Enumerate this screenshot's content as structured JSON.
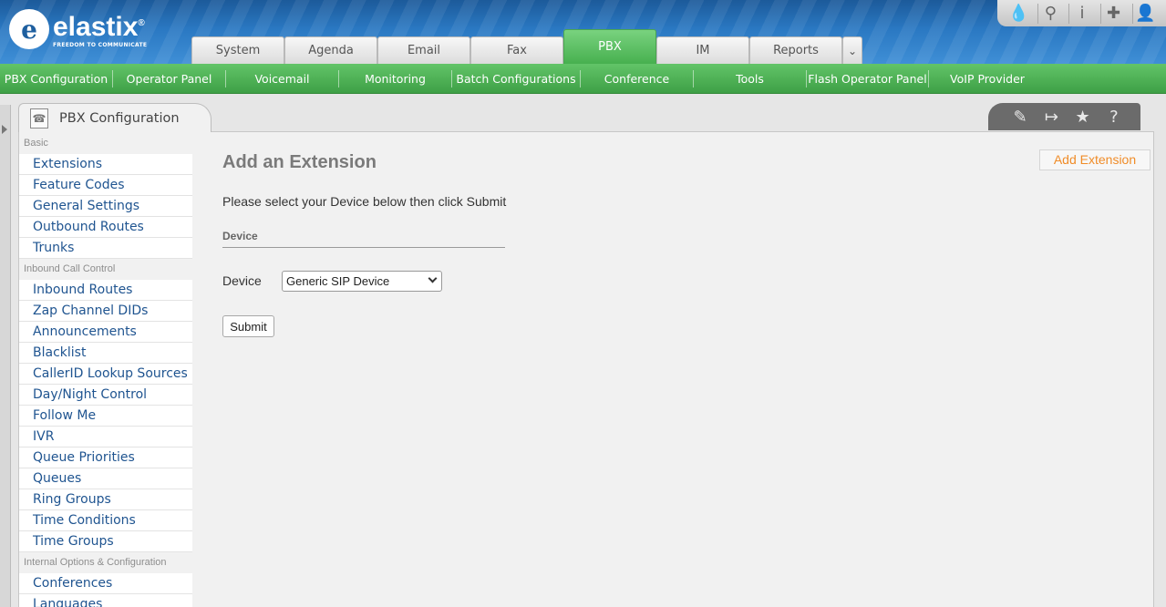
{
  "brand": {
    "name": "elastix",
    "registered": "®",
    "slogan": "FREEDOM TO COMMUNICATE"
  },
  "top_icons": [
    {
      "name": "theme-drop-icon",
      "glyph": "💧"
    },
    {
      "name": "search-icon",
      "glyph": "⚲"
    },
    {
      "name": "info-icon",
      "glyph": "i"
    },
    {
      "name": "addons-puzzle-icon",
      "glyph": "✚"
    },
    {
      "name": "user-icon",
      "glyph": "👤"
    }
  ],
  "tabs": [
    {
      "label": "System",
      "active": false
    },
    {
      "label": "Agenda",
      "active": false
    },
    {
      "label": "Email",
      "active": false
    },
    {
      "label": "Fax",
      "active": false
    },
    {
      "label": "PBX",
      "active": true
    },
    {
      "label": "IM",
      "active": false
    },
    {
      "label": "Reports",
      "active": false
    }
  ],
  "tab_more_glyph": "⌄",
  "subnav": [
    "PBX Configuration",
    "Operator Panel",
    "Voicemail",
    "Monitoring",
    "Batch Configurations",
    "Conference",
    "Tools",
    "Flash Operator Panel",
    "VoIP Provider"
  ],
  "module": {
    "title": "PBX Configuration"
  },
  "right_tools": [
    {
      "name": "edit-icon",
      "glyph": "✎"
    },
    {
      "name": "export-icon",
      "glyph": "↦"
    },
    {
      "name": "favorite-star-icon",
      "glyph": "★"
    },
    {
      "name": "help-icon",
      "glyph": "?"
    }
  ],
  "sidebar": {
    "sections": [
      {
        "title": "Basic",
        "items": [
          "Extensions",
          "Feature Codes",
          "General Settings",
          "Outbound Routes",
          "Trunks"
        ]
      },
      {
        "title": "Inbound Call Control",
        "items": [
          "Inbound Routes",
          "Zap Channel DIDs",
          "Announcements",
          "Blacklist",
          "CallerID Lookup Sources",
          "Day/Night Control",
          "Follow Me",
          "IVR",
          "Queue Priorities",
          "Queues",
          "Ring Groups",
          "Time Conditions",
          "Time Groups"
        ]
      },
      {
        "title": "Internal Options & Configuration",
        "items": [
          "Conferences",
          "Languages"
        ]
      }
    ]
  },
  "main": {
    "title": "Add an Extension",
    "instructions": "Please select your Device below then click Submit",
    "section": "Device",
    "device_label": "Device",
    "device_selected": "Generic SIP Device",
    "submit_label": "Submit",
    "add_extension_label": "Add Extension"
  },
  "colors": {
    "accent_green": "#47b04f",
    "link_blue": "#1f5490",
    "add_extension_orange": "#f08c28"
  }
}
